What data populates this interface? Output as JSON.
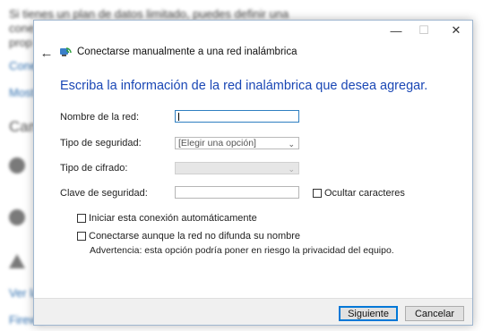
{
  "background": {
    "lines": [
      "Si tienes un plan de datos limitado, puedes definir una",
      "cone",
      "prop",
      "Conec",
      "Most",
      "Cam",
      "Ver la",
      "Firewa"
    ]
  },
  "window": {
    "minimize_glyph": "—",
    "maximize_glyph": "☐",
    "close_glyph": "✕",
    "back_glyph": "←",
    "title": "Conectarse manualmente a una red inalámbrica"
  },
  "heading": "Escriba la información de la red inalámbrica que desea agregar.",
  "form": {
    "network_name": {
      "label": "Nombre de la red:",
      "value": ""
    },
    "security_type": {
      "label": "Tipo de seguridad:",
      "value": "[Elegir una opción]"
    },
    "encryption_type": {
      "label": "Tipo de cifrado:",
      "value": ""
    },
    "security_key": {
      "label": "Clave de seguridad:",
      "value": ""
    },
    "hide_chars": {
      "label": "Ocultar caracteres",
      "checked": false
    },
    "auto_connect": {
      "label": "Iniciar esta conexión automáticamente",
      "checked": false
    },
    "connect_hidden": {
      "label": "Conectarse aunque la red no difunda su nombre",
      "checked": false
    },
    "warning": "Advertencia: esta opción podría poner en riesgo la privacidad del equipo."
  },
  "buttons": {
    "next": "Siguiente",
    "cancel": "Cancelar"
  },
  "icons": {
    "back": "back-arrow-icon",
    "network": "wireless-network-icon",
    "chevron": "chevron-down-icon"
  },
  "colors": {
    "heading": "#1a47b5",
    "accent": "#0078d7",
    "link": "#2f6fb0"
  }
}
